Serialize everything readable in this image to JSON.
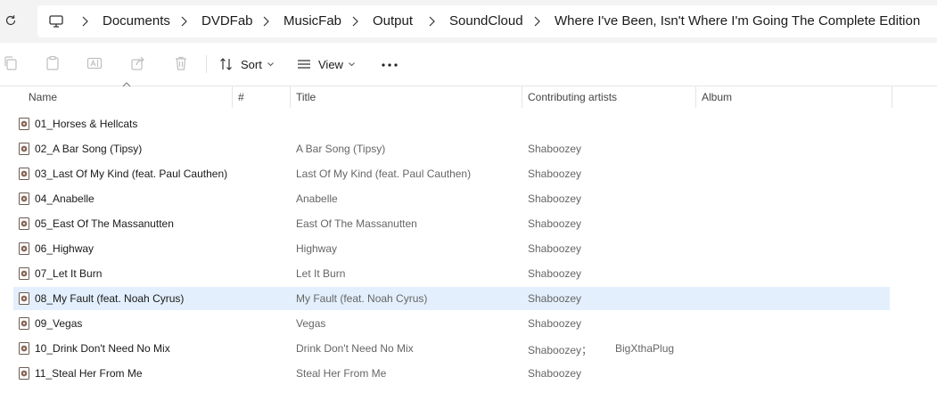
{
  "window": {
    "breadcrumb": [
      "Documents",
      "DVDFab",
      "MusicFab",
      "Output",
      "SoundCloud",
      "Where I've Been, Isn't Where I'm Going The Complete Edition"
    ]
  },
  "toolbar": {
    "sort_label": "Sort",
    "view_label": "View",
    "icons": [
      "copy-icon",
      "paste-icon",
      "rename-icon",
      "share-icon",
      "delete-icon",
      "sort-icon",
      "view-icon",
      "more-icon"
    ]
  },
  "columns": {
    "name": "Name",
    "number": "#",
    "title": "Title",
    "artists": "Contributing artists",
    "album": "Album"
  },
  "files": [
    {
      "name": "01_Horses & Hellcats",
      "title": "",
      "artist": "",
      "artist2": "",
      "selected": false
    },
    {
      "name": "02_A Bar Song (Tipsy)",
      "title": "A Bar Song (Tipsy)",
      "artist": "Shaboozey",
      "artist2": "",
      "selected": false
    },
    {
      "name": "03_Last Of My Kind (feat. Paul Cauthen)",
      "title": "Last Of My Kind (feat. Paul Cauthen)",
      "artist": "Shaboozey",
      "artist2": "",
      "selected": false
    },
    {
      "name": "04_Anabelle",
      "title": "Anabelle",
      "artist": "Shaboozey",
      "artist2": "",
      "selected": false
    },
    {
      "name": "05_East Of The Massanutten",
      "title": "East Of The Massanutten",
      "artist": "Shaboozey",
      "artist2": "",
      "selected": false
    },
    {
      "name": "06_Highway",
      "title": "Highway",
      "artist": "Shaboozey",
      "artist2": "",
      "selected": false
    },
    {
      "name": "07_Let It Burn",
      "title": "Let It Burn",
      "artist": "Shaboozey",
      "artist2": "",
      "selected": false
    },
    {
      "name": "08_My Fault (feat. Noah Cyrus)",
      "title": "My Fault (feat. Noah Cyrus)",
      "artist": "Shaboozey",
      "artist2": "",
      "selected": true
    },
    {
      "name": "09_Vegas",
      "title": "Vegas",
      "artist": "Shaboozey",
      "artist2": "",
      "selected": false
    },
    {
      "name": "10_Drink Don't Need No Mix",
      "title": "Drink Don't Need No Mix",
      "artist": "Shaboozey；",
      "artist2": "BigXthaPlug",
      "selected": false
    },
    {
      "name": "11_Steal Her From Me",
      "title": "Steal Her From Me",
      "artist": "Shaboozey",
      "artist2": "",
      "selected": false
    }
  ],
  "colors": {
    "selected_row": "#e3effc",
    "addressbar_bg": "#f3f3f3",
    "file_icon": "#8a6a5a"
  }
}
